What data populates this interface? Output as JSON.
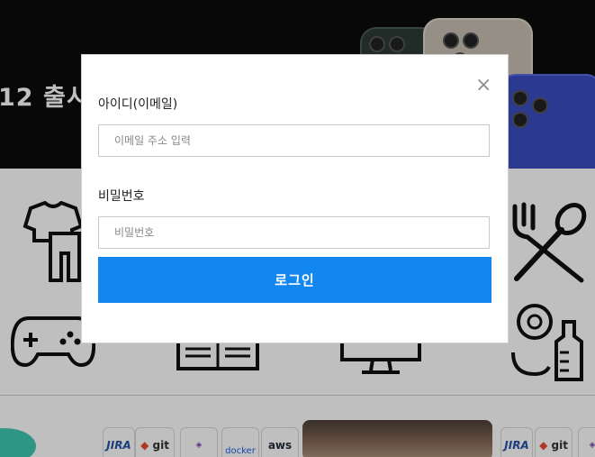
{
  "background": {
    "banner_title": "12 출시",
    "banner_subtitle": ")"
  },
  "categories": [
    {
      "icon": "clothing-icon"
    },
    {
      "icon": "utensils-icon"
    },
    {
      "icon": "gamepad-icon"
    },
    {
      "icon": "book-icon"
    },
    {
      "icon": "computer-icon"
    },
    {
      "icon": "baby-bottle-icon"
    }
  ],
  "stack_logos": [
    "JIRA",
    "git",
    "docker",
    "aws"
  ],
  "login_modal": {
    "id_label": "아이디(이메일)",
    "id_placeholder": "이메일 주소 입력",
    "password_label": "비밀번호",
    "password_placeholder": "비밀번호",
    "login_button": "로그인",
    "close_symbol": "×"
  },
  "colors": {
    "primary": "#1187ef",
    "overlay": "rgba(0,0,0,0.25)",
    "banner": "#0b0b0b"
  }
}
